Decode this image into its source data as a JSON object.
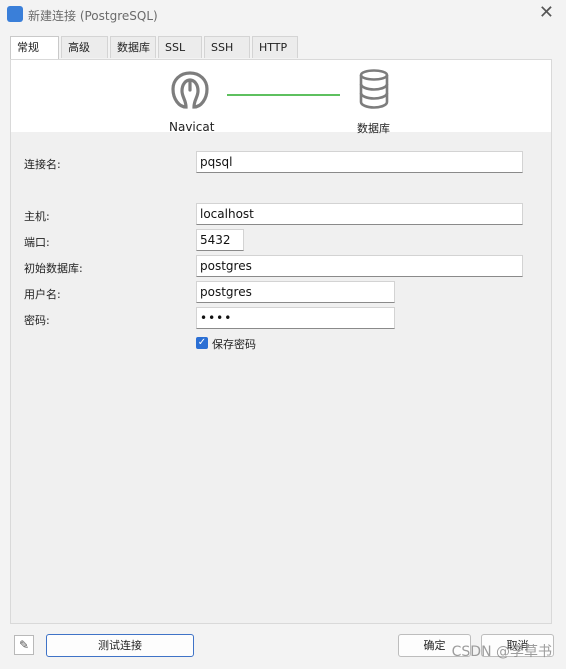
{
  "window": {
    "title": "新建连接 (PostgreSQL)",
    "close_glyph": "✕"
  },
  "tabs": [
    {
      "label": "常规",
      "active": true
    },
    {
      "label": "高级"
    },
    {
      "label": "数据库"
    },
    {
      "label": "SSL"
    },
    {
      "label": "SSH"
    },
    {
      "label": "HTTP"
    }
  ],
  "banner": {
    "left_label": "Navicat",
    "right_label": "数据库",
    "line_color": "#5ec05f"
  },
  "form": {
    "connection_name_label": "连接名:",
    "connection_name_value": "pqsql",
    "host_label": "主机:",
    "host_value": "localhost",
    "port_label": "端口:",
    "port_value": "5432",
    "initial_db_label": "初始数据库:",
    "initial_db_value": "postgres",
    "username_label": "用户名:",
    "username_value": "postgres",
    "password_label": "密码:",
    "password_value": "••••",
    "save_password_label": "保存密码",
    "save_password_checked": true
  },
  "footer": {
    "test_button": "测试连接",
    "ok_button": "确定",
    "cancel_button": "取消",
    "watermark": "CSDN @李草书"
  },
  "colors": {
    "accent": "#2b6fd4"
  }
}
